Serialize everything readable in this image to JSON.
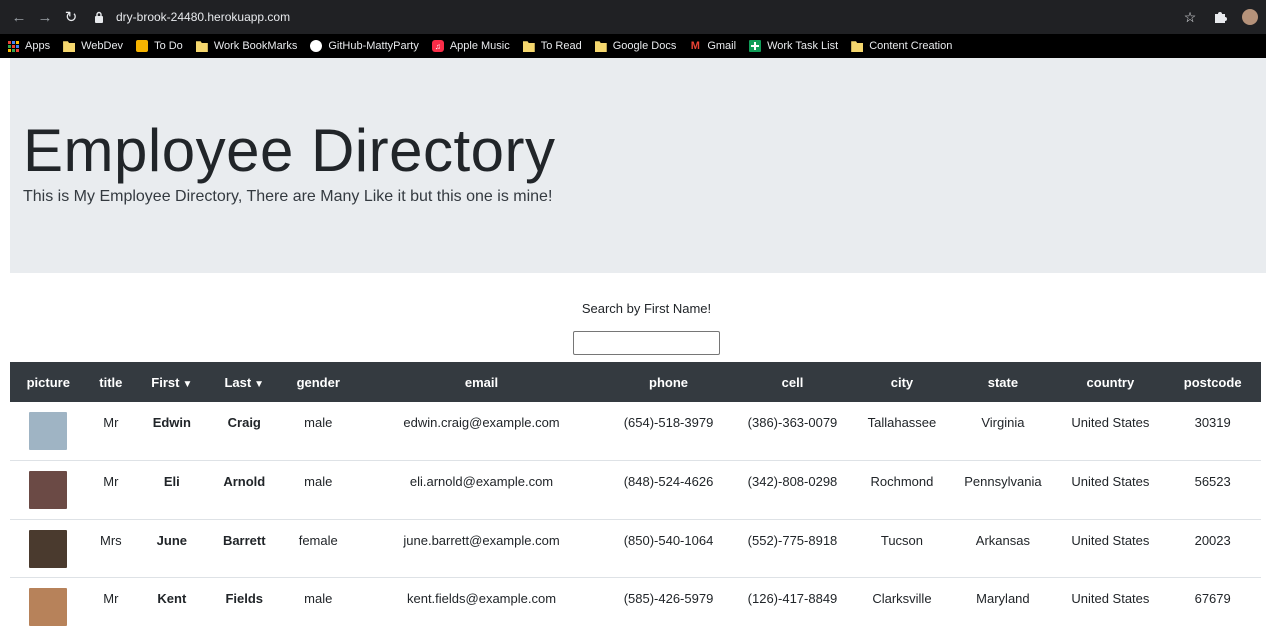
{
  "browser": {
    "url": "dry-brook-24480.herokuapp.com",
    "bookmarks": [
      {
        "label": "Apps",
        "icon": "apps-grid-icon"
      },
      {
        "label": "WebDev",
        "icon": "folder-icon"
      },
      {
        "label": "To Do",
        "icon": "todo-icon"
      },
      {
        "label": "Work BookMarks",
        "icon": "folder-icon"
      },
      {
        "label": "GitHub-MattyParty",
        "icon": "github-icon"
      },
      {
        "label": "Apple Music",
        "icon": "apple-music-icon"
      },
      {
        "label": "To Read",
        "icon": "folder-icon"
      },
      {
        "label": "Google Docs",
        "icon": "folder-icon"
      },
      {
        "label": "Gmail",
        "icon": "gmail-icon"
      },
      {
        "label": "Work Task List",
        "icon": "sheets-icon"
      },
      {
        "label": "Content Creation",
        "icon": "folder-icon"
      }
    ]
  },
  "header": {
    "title": "Employee Directory",
    "subtitle": "This is My Employee Directory, There are Many Like it but this one is mine!"
  },
  "search": {
    "label": "Search by First Name!",
    "value": ""
  },
  "table": {
    "columns": [
      "picture",
      "title",
      "First",
      "Last",
      "gender",
      "email",
      "phone",
      "cell",
      "city",
      "state",
      "country",
      "postcode"
    ],
    "sort_arrow": "▼",
    "rows": [
      {
        "avatar_color": "#9fb4c4",
        "title": "Mr",
        "first": "Edwin",
        "last": "Craig",
        "gender": "male",
        "email": "edwin.craig@example.com",
        "phone": "(654)-518-3979",
        "cell": "(386)-363-0079",
        "city": "Tallahassee",
        "state": "Virginia",
        "country": "United States",
        "postcode": "30319"
      },
      {
        "avatar_color": "#6b4a45",
        "title": "Mr",
        "first": "Eli",
        "last": "Arnold",
        "gender": "male",
        "email": "eli.arnold@example.com",
        "phone": "(848)-524-4626",
        "cell": "(342)-808-0298",
        "city": "Rochmond",
        "state": "Pennsylvania",
        "country": "United States",
        "postcode": "56523"
      },
      {
        "avatar_color": "#4a3a2e",
        "title": "Mrs",
        "first": "June",
        "last": "Barrett",
        "gender": "female",
        "email": "june.barrett@example.com",
        "phone": "(850)-540-1064",
        "cell": "(552)-775-8918",
        "city": "Tucson",
        "state": "Arkansas",
        "country": "United States",
        "postcode": "20023"
      },
      {
        "avatar_color": "#b7825a",
        "title": "Mr",
        "first": "Kent",
        "last": "Fields",
        "gender": "male",
        "email": "kent.fields@example.com",
        "phone": "(585)-426-5979",
        "cell": "(126)-417-8849",
        "city": "Clarksville",
        "state": "Maryland",
        "country": "United States",
        "postcode": "67679"
      }
    ]
  }
}
